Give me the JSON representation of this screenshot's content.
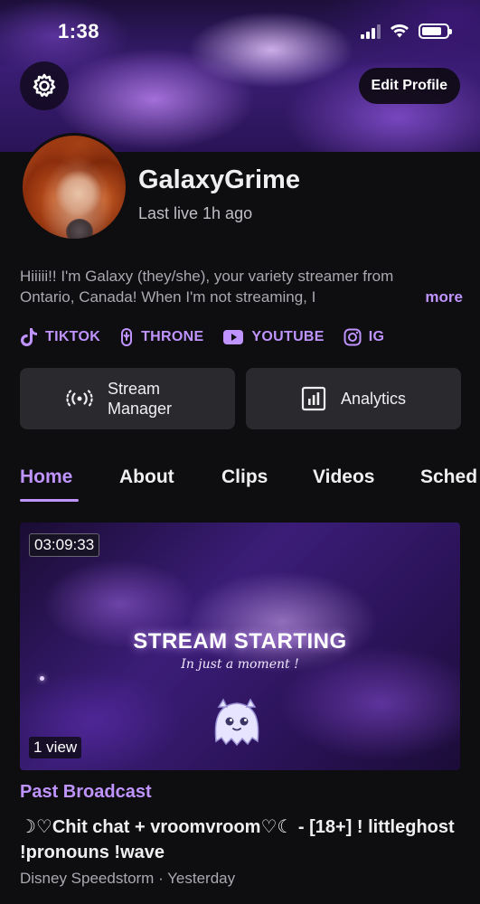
{
  "status_bar": {
    "time": "1:38",
    "battery_level": 0.8
  },
  "header": {
    "edit_profile_label": "Edit Profile",
    "settings_icon": "gear-icon"
  },
  "profile": {
    "display_name": "GalaxyGrime",
    "last_live": "Last live 1h ago",
    "bio": "Hiiiii!! I'm Galaxy (they/she), your variety streamer from Ontario, Canada! When I'm not streaming, I",
    "bio_more": "more"
  },
  "socials": [
    {
      "label": "TIKTOK",
      "icon": "tiktok-icon"
    },
    {
      "label": "THRONE",
      "icon": "throne-icon"
    },
    {
      "label": "YOUTUBE",
      "icon": "youtube-icon"
    },
    {
      "label": "IG",
      "icon": "instagram-icon"
    }
  ],
  "actions": {
    "stream_manager": "Stream Manager",
    "analytics": "Analytics"
  },
  "tabs": [
    "Home",
    "About",
    "Clips",
    "Videos",
    "Sched"
  ],
  "active_tab": "Home",
  "video": {
    "duration": "03:09:33",
    "views": "1 view",
    "thumbnail_title": "STREAM STARTING",
    "thumbnail_subtitle": "In just a moment !",
    "type": "Past Broadcast",
    "title": "☽♡Chit chat + vroomvroom♡☾ -  [18+] ! littleghost !pronouns !wave",
    "meta": "Disney Speedstorm · Yesterday"
  },
  "colors": {
    "accent": "#bf94ff",
    "background": "#0e0e10",
    "button_bg": "#2a2a2e"
  }
}
